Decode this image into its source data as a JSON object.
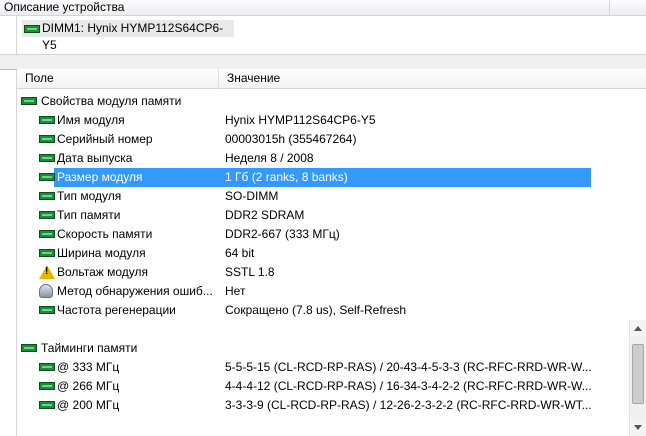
{
  "description_pane": {
    "header": "Описание устройства",
    "device": "DIMM1: Hynix HYMP112S64CP6-Y5"
  },
  "columns": {
    "field": "Поле",
    "value": "Значение"
  },
  "groups": [
    {
      "title": "Свойства модуля памяти",
      "rows": [
        {
          "field": "Имя модуля",
          "value": "Hynix HYMP112S64CP6-Y5",
          "icon": "ram-icon"
        },
        {
          "field": "Серийный номер",
          "value": "00003015h (355467264)",
          "icon": "ram-icon"
        },
        {
          "field": "Дата выпуска",
          "value": "Неделя 8 / 2008",
          "icon": "ram-icon"
        },
        {
          "field": "Размер модуля",
          "value": "1 Гб (2 ranks, 8 banks)",
          "icon": "ram-icon",
          "selected": true
        },
        {
          "field": "Тип модуля",
          "value": "SO-DIMM",
          "icon": "ram-icon"
        },
        {
          "field": "Тип памяти",
          "value": "DDR2 SDRAM",
          "icon": "ram-icon"
        },
        {
          "field": "Скорость памяти",
          "value": "DDR2-667 (333 МГц)",
          "icon": "ram-icon"
        },
        {
          "field": "Ширина модуля",
          "value": "64 bit",
          "icon": "ram-icon"
        },
        {
          "field": "Вольтаж модуля",
          "value": "SSTL 1.8",
          "icon": "warning-icon"
        },
        {
          "field": "Метод обнаружения ошиб...",
          "value": "Нет",
          "icon": "disk-icon"
        },
        {
          "field": "Частота регенерации",
          "value": "Сокращено (7.8 us), Self-Refresh",
          "icon": "ram-icon"
        }
      ]
    },
    {
      "title": "Тайминги памяти",
      "rows": [
        {
          "field": "@ 333 МГц",
          "value": "5-5-5-15  (CL-RCD-RP-RAS) / 20-43-4-5-3-3  (RC-RFC-RRD-WR-W...",
          "icon": "ram-icon"
        },
        {
          "field": "@ 266 МГц",
          "value": "4-4-4-12  (CL-RCD-RP-RAS) / 16-34-3-4-2-2  (RC-RFC-RRD-WR-W...",
          "icon": "ram-icon"
        },
        {
          "field": "@ 200 МГц",
          "value": "3-3-3-9  (CL-RCD-RP-RAS) / 12-26-2-3-2-2  (RC-RFC-RRD-WR-WT...",
          "icon": "ram-icon"
        }
      ]
    }
  ],
  "colors": {
    "selection": "#3399ff",
    "module_icon": "#1f8a3c"
  }
}
